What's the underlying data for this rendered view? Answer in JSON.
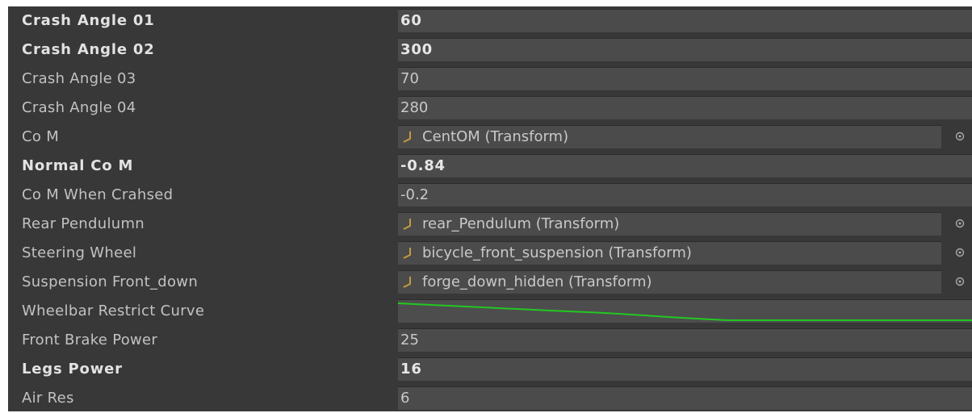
{
  "inspector": {
    "fields": [
      {
        "label": "Crash Angle 01",
        "value": "60",
        "bold": true
      },
      {
        "label": "Crash Angle 02",
        "value": "300",
        "bold": true
      },
      {
        "label": "Crash Angle 03",
        "value": "70",
        "bold": false
      },
      {
        "label": "Crash Angle 04",
        "value": "280",
        "bold": false
      },
      {
        "label": "Co M",
        "value": "CentOM (Transform)",
        "bold": false,
        "type": "object",
        "icon": "transform-icon"
      },
      {
        "label": "Normal Co M",
        "value": "-0.84",
        "bold": true
      },
      {
        "label": "Co M When Crahsed",
        "value": "-0.2",
        "bold": false
      },
      {
        "label": "Rear Pendulumn",
        "value": "rear_Pendulum (Transform)",
        "bold": false,
        "type": "object",
        "icon": "transform-icon"
      },
      {
        "label": "Steering Wheel",
        "value": "bicycle_front_suspension (Transform)",
        "bold": false,
        "type": "object",
        "icon": "transform-icon"
      },
      {
        "label": "Suspension Front_down",
        "value": "forge_down_hidden (Transform)",
        "bold": false,
        "type": "object",
        "icon": "transform-icon"
      },
      {
        "label": "Wheelbar Restrict Curve",
        "bold": false,
        "type": "curve",
        "curve_color": "#22c822"
      },
      {
        "label": "Front Brake Power",
        "value": "25",
        "bold": false
      },
      {
        "label": "Legs Power",
        "value": "16",
        "bold": true
      },
      {
        "label": "Air Res",
        "value": "6",
        "bold": false
      }
    ]
  },
  "colors": {
    "panel_background": "#383838",
    "field_background": "#4b4b4b",
    "label_text": "#c2c2c2",
    "bold_text": "#e2e2e2",
    "curve_line": "#22c822"
  }
}
